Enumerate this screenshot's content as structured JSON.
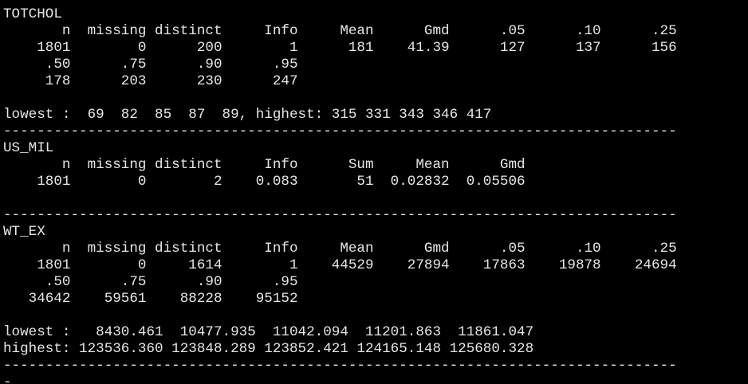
{
  "terminal": {
    "lines": [
      "--------------------------------------------------------------------------------",
      "TOTCHOL",
      "       n  missing distinct     Info     Mean      Gmd      .05      .10      .25",
      "    1801        0      200        1      181    41.39      127      137      156",
      "     .50      .75      .90      .95",
      "     178      203      230      247",
      "",
      "lowest :  69  82  85  87  89, highest: 315 331 343 346 417",
      "--------------------------------------------------------------------------------",
      "US_MIL",
      "       n  missing distinct     Info      Sum     Mean      Gmd",
      "    1801        0        2    0.083       51  0.02832  0.05506",
      "",
      "--------------------------------------------------------------------------------",
      "WT_EX",
      "       n  missing distinct     Info     Mean      Gmd      .05      .10      .25",
      "    1801        0     1614        1    44529    27894    17863    19878    24694",
      "     .50      .75      .90      .95",
      "   34642    59561    88228    95152",
      "",
      "lowest :   8430.461  10477.935  11042.094  11201.863  11861.047",
      "highest: 123536.360 123848.289 123852.421 124165.148 125680.328",
      "--------------------------------------------------------------------------------",
      "- "
    ]
  }
}
